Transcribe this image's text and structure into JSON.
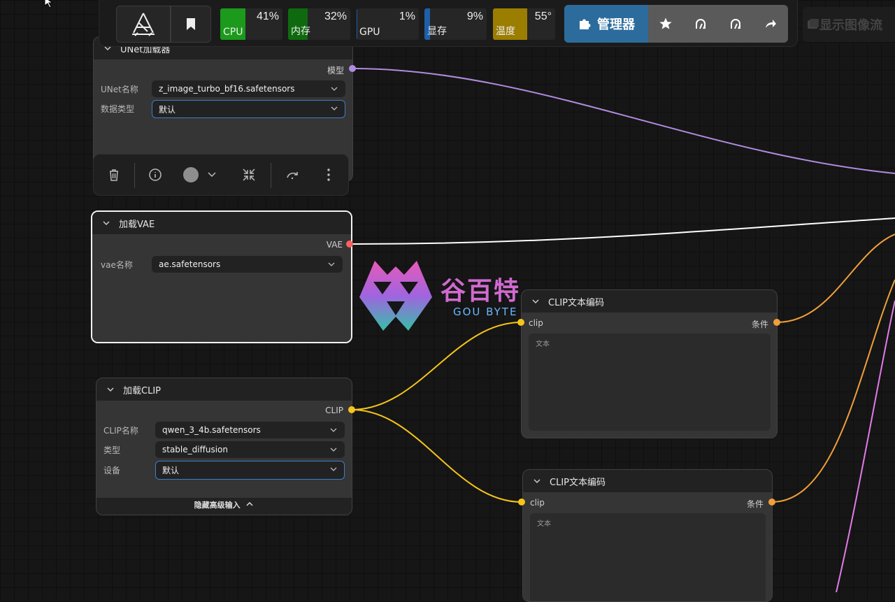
{
  "toolbar": {
    "logo_icon": "comfy-logo-icon",
    "bookmark_icon": "bookmark-icon",
    "meters": [
      {
        "label": "CPU",
        "value": "41%",
        "fraction": 0.41,
        "color": "#1b9a1b"
      },
      {
        "label": "内存",
        "value": "32%",
        "fraction": 0.32,
        "color": "#0f6a0f"
      },
      {
        "label": "GPU",
        "value": "1%",
        "fraction": 0.01,
        "color": "#1f5fa8"
      },
      {
        "label": "显存",
        "value": "9%",
        "fraction": 0.09,
        "color": "#1f5fa8"
      },
      {
        "label": "温度",
        "value": "55°",
        "fraction": 0.55,
        "color": "#9b7d00"
      }
    ],
    "manager_label": "管理器",
    "manager_icons": [
      "puzzle-icon",
      "star-icon",
      "restart-icon",
      "restart-alt-icon",
      "share-icon"
    ],
    "show_flow_label": "显示图像流"
  },
  "selection_toolbar": {
    "icons": [
      "trash-icon",
      "info-icon",
      "color-picker-icon",
      "collapse-icon",
      "bypass-icon",
      "more-icon"
    ]
  },
  "nodes": {
    "unet": {
      "title": "UNet加载器",
      "output": "模型",
      "widgets": [
        {
          "label": "UNet名称",
          "value": "z_image_turbo_bf16.safetensors"
        },
        {
          "label": "数据类型",
          "value": "默认"
        }
      ]
    },
    "vae": {
      "title": "加载VAE",
      "output": "VAE",
      "widgets": [
        {
          "label": "vae名称",
          "value": "ae.safetensors"
        }
      ]
    },
    "clip": {
      "title": "加载CLIP",
      "output": "CLIP",
      "widgets": [
        {
          "label": "CLIP名称",
          "value": "qwen_3_4b.safetensors"
        },
        {
          "label": "类型",
          "value": "stable_diffusion"
        },
        {
          "label": "设备",
          "value": "默认"
        }
      ],
      "toggle_advanced": "隐藏高级输入"
    },
    "clip_encode_1": {
      "title": "CLIP文本编码",
      "input": "clip",
      "output": "条件",
      "text_placeholder": "文本"
    },
    "clip_encode_2": {
      "title": "CLIP文本编码",
      "input": "clip",
      "output": "条件",
      "text_placeholder": "文本"
    }
  },
  "watermark": {
    "cn": "谷百特",
    "en": "GOU BYTE"
  },
  "colors": {
    "model_link": "#b08ce0",
    "vae_link": "#ffffff",
    "clip_link": "#f5c518",
    "cond_link": "#f0a03a",
    "pink_link": "#e27be8",
    "vae_dot": "#ff5f5f"
  }
}
